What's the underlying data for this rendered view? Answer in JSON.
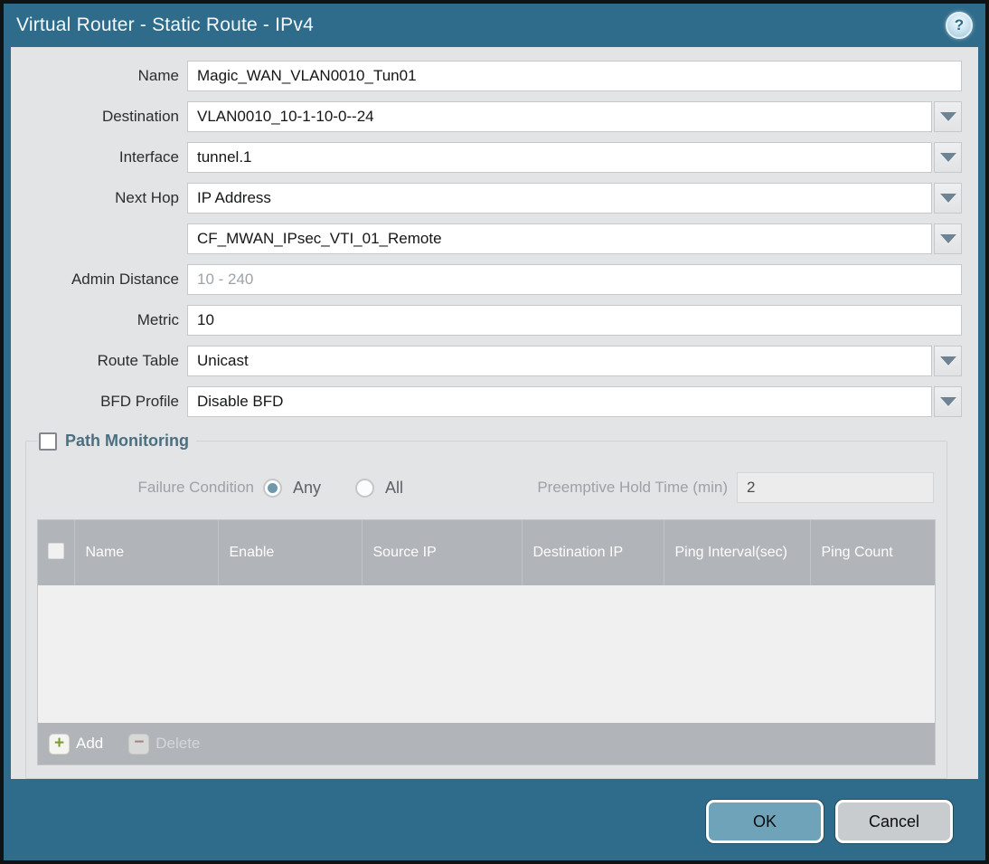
{
  "titlebar": {
    "title": "Virtual Router - Static Route - IPv4",
    "help_glyph": "?"
  },
  "form": {
    "name": {
      "label": "Name",
      "value": "Magic_WAN_VLAN0010_Tun01"
    },
    "destination": {
      "label": "Destination",
      "value": "VLAN0010_10-1-10-0--24"
    },
    "interface": {
      "label": "Interface",
      "value": "tunnel.1"
    },
    "next_hop": {
      "label": "Next Hop",
      "value": "IP Address"
    },
    "next_hop_address": {
      "value": "CF_MWAN_IPsec_VTI_01_Remote"
    },
    "admin_distance": {
      "label": "Admin Distance",
      "placeholder": "10 - 240",
      "value": ""
    },
    "metric": {
      "label": "Metric",
      "value": "10"
    },
    "route_table": {
      "label": "Route Table",
      "value": "Unicast"
    },
    "bfd_profile": {
      "label": "BFD Profile",
      "value": "Disable BFD"
    }
  },
  "path_monitoring": {
    "legend": "Path Monitoring",
    "checkbox_checked": false,
    "failure_condition": {
      "label": "Failure Condition",
      "options": [
        "Any",
        "All"
      ],
      "selected": "Any"
    },
    "preemptive_hold_time": {
      "label": "Preemptive Hold Time (min)",
      "value": "2"
    },
    "table": {
      "columns": [
        "Name",
        "Enable",
        "Source IP",
        "Destination IP",
        "Ping Interval(sec)",
        "Ping Count"
      ],
      "rows": []
    },
    "toolbar": {
      "add_label": "Add",
      "add_glyph": "+",
      "delete_label": "Delete",
      "delete_glyph": "−"
    }
  },
  "footer": {
    "ok_label": "OK",
    "cancel_label": "Cancel"
  },
  "colors": {
    "frame_teal": "#2f6c8b",
    "content_bg": "#e3e4e5",
    "table_header_bg": "#b1b5b9",
    "ok_button_bg": "#6fa3ba",
    "cancel_button_bg": "#c8cccf",
    "legend_text": "#4c6f80",
    "radio_selected": "#7098ab",
    "add_icon_green": "#7f9c34",
    "delete_icon_red": "#a2675e"
  }
}
